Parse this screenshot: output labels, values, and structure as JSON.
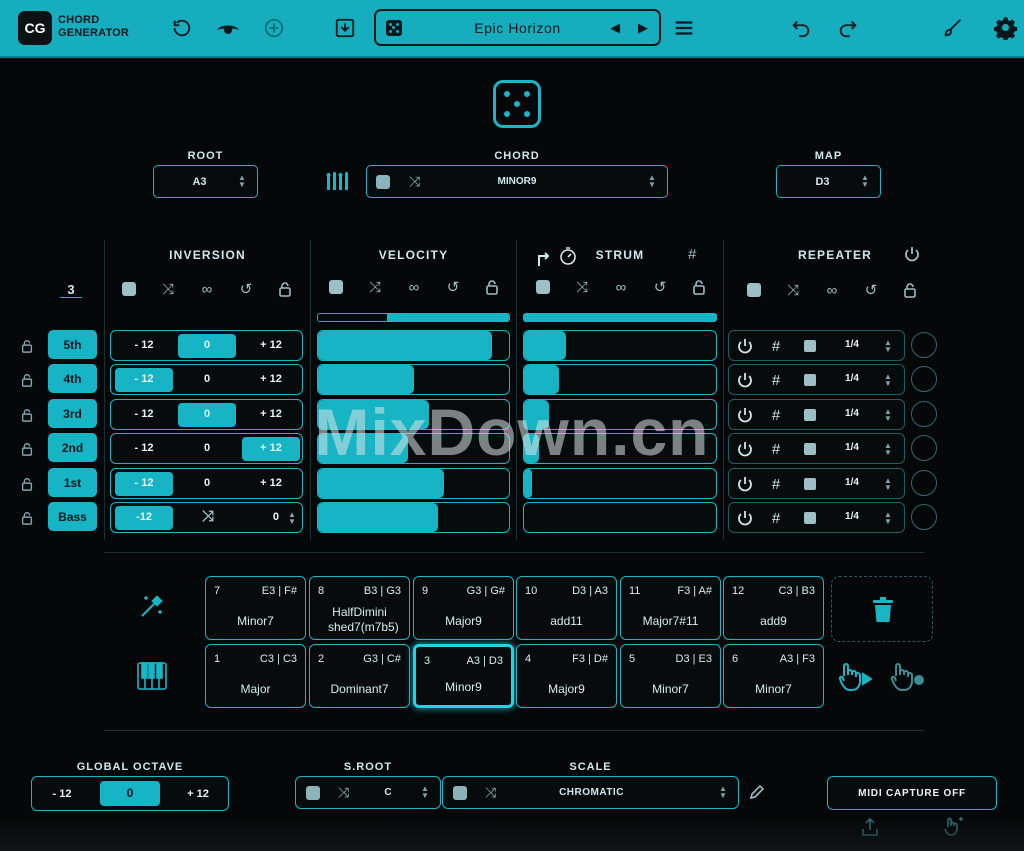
{
  "app": {
    "logo": "CG",
    "name_line1": "CHORD",
    "name_line2": "GENERATOR"
  },
  "preset": {
    "name": "Epic Horizon"
  },
  "root": {
    "label": "ROOT",
    "value": "A3"
  },
  "chord": {
    "label": "CHORD",
    "value": "MINOR9"
  },
  "map": {
    "label": "MAP",
    "value": "D3"
  },
  "sections": {
    "inversion": "INVERSION",
    "velocity": "VELOCITY",
    "strum": "STRUM",
    "repeater": "REPEATER"
  },
  "inversion_count": "3",
  "voices": [
    {
      "label": "5th",
      "inv_left": "- 12",
      "inv_mid": "0",
      "inv_right": "+ 12",
      "inv_selected": "mid",
      "velocity": 0.91,
      "strum": 0.22,
      "rep_rate": "1/4"
    },
    {
      "label": "4th",
      "inv_left": "- 12",
      "inv_mid": "0",
      "inv_right": "+ 12",
      "inv_selected": "left",
      "velocity": 0.5,
      "strum": 0.18,
      "rep_rate": "1/4"
    },
    {
      "label": "3rd",
      "inv_left": "- 12",
      "inv_mid": "0",
      "inv_right": "+ 12",
      "inv_selected": "mid",
      "velocity": 0.58,
      "strum": 0.13,
      "rep_rate": "1/4"
    },
    {
      "label": "2nd",
      "inv_left": "- 12",
      "inv_mid": "0",
      "inv_right": "+ 12",
      "inv_selected": "right",
      "velocity": 0.47,
      "strum": 0.08,
      "rep_rate": "1/4"
    },
    {
      "label": "1st",
      "inv_left": "- 12",
      "inv_mid": "0",
      "inv_right": "+ 12",
      "inv_selected": "left",
      "velocity": 0.66,
      "strum": 0.04,
      "rep_rate": "1/4"
    },
    {
      "label": "Bass",
      "inv_left": "-12",
      "inv_mid": "",
      "inv_right": "0",
      "inv_selected": "left",
      "velocity": 0.63,
      "strum": 0.0,
      "rep_rate": "1/4"
    }
  ],
  "velocity_master": 0.36,
  "strum_master": 1.0,
  "chord_slots_top": [
    {
      "num": "7",
      "notes": "E3 | F#",
      "name": "Minor7"
    },
    {
      "num": "8",
      "notes": "B3 | G3",
      "name": "HalfDimini shed7(m7b5)"
    },
    {
      "num": "9",
      "notes": "G3 | G#",
      "name": "Major9"
    },
    {
      "num": "10",
      "notes": "D3 | A3",
      "name": "add11"
    },
    {
      "num": "11",
      "notes": "F3 | A#",
      "name": "Major7#11"
    },
    {
      "num": "12",
      "notes": "C3 | B3",
      "name": "add9"
    }
  ],
  "chord_slots_bottom": [
    {
      "num": "1",
      "notes": "C3 | C3",
      "name": "Major"
    },
    {
      "num": "2",
      "notes": "G3 | C#",
      "name": "Dominant7"
    },
    {
      "num": "3",
      "notes": "A3 | D3",
      "name": "Minor9"
    },
    {
      "num": "4",
      "notes": "F3 | D#",
      "name": "Major9"
    },
    {
      "num": "5",
      "notes": "D3 | E3",
      "name": "Minor7"
    },
    {
      "num": "6",
      "notes": "A3 | F3",
      "name": "Minor7"
    }
  ],
  "global_octave": {
    "label": "GLOBAL OCTAVE",
    "minus": "- 12",
    "value": "0",
    "plus": "+ 12"
  },
  "s_root": {
    "label": "S.ROOT",
    "value": "C"
  },
  "scale": {
    "label": "SCALE",
    "value": "CHROMATIC"
  },
  "midi_capture": {
    "label": "MIDI CAPTURE OFF"
  },
  "watermark": "MixDown.cn",
  "colors": {
    "accent": "#16b4c5",
    "bg": "#050708",
    "text": "#cfe9ee"
  }
}
